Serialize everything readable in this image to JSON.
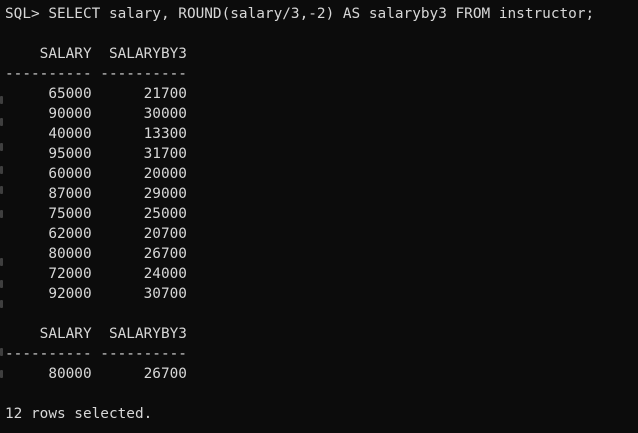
{
  "window": {
    "background": "#0c0c0c",
    "text_color": "#d7d7d7"
  },
  "console": {
    "command_line": "SQL> SELECT salary, ROUND(salary/3,-2) AS salaryby3 FROM instructor;",
    "header_1": "    SALARY  SALARYBY3",
    "separator_1": "---------- ----------",
    "rows_page_1": [
      "     65000      21700",
      "     90000      30000",
      "     40000      13300",
      "     95000      31700",
      "     60000      20000",
      "     87000      29000",
      "     75000      25000",
      "     62000      20700",
      "     80000      26700",
      "     72000      24000",
      "     92000      30700"
    ],
    "header_2": "    SALARY  SALARYBY3",
    "separator_2": "---------- ----------",
    "rows_page_2": [
      "     80000      26700"
    ],
    "footer": "12 rows selected."
  }
}
